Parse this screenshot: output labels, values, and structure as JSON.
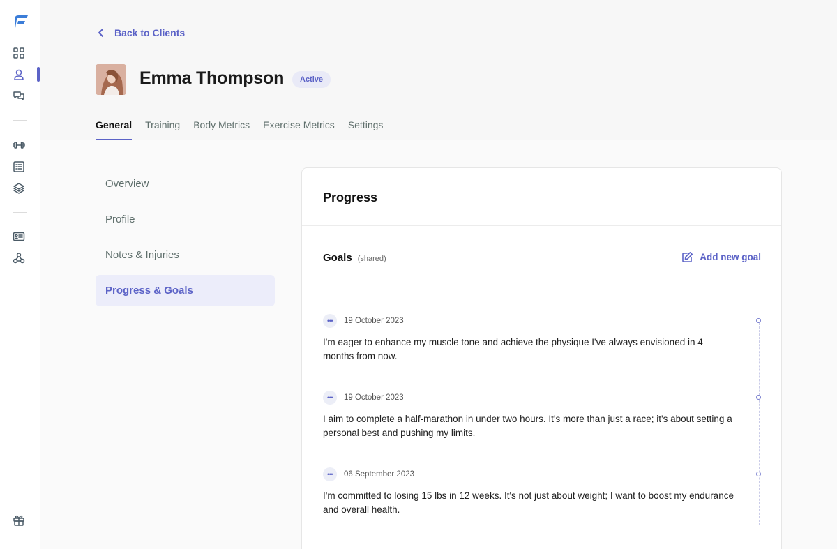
{
  "header": {
    "back_label": "Back to Clients",
    "client_name": "Emma Thompson",
    "status": "Active"
  },
  "tabs": [
    {
      "label": "General",
      "active": true
    },
    {
      "label": "Training",
      "active": false
    },
    {
      "label": "Body Metrics",
      "active": false
    },
    {
      "label": "Exercise Metrics",
      "active": false
    },
    {
      "label": "Settings",
      "active": false
    }
  ],
  "subnav": [
    {
      "label": "Overview",
      "active": false
    },
    {
      "label": "Profile",
      "active": false
    },
    {
      "label": "Notes & Injuries",
      "active": false
    },
    {
      "label": "Progress & Goals",
      "active": true
    }
  ],
  "card": {
    "title": "Progress",
    "goals_title": "Goals",
    "goals_subtitle": "(shared)",
    "add_goal_label": "Add new goal",
    "goals": [
      {
        "date": "19 October 2023",
        "text": "I'm eager to enhance my muscle tone and achieve the physique I've always envisioned in 4 months from now."
      },
      {
        "date": "19 October 2023",
        "text": "I aim to complete a half-marathon in under two hours. It's more than just a race; it's about setting a personal best and pushing my limits."
      },
      {
        "date": "06 September 2023",
        "text": "I'm committed to losing 15 lbs in 12 weeks. It's not just about weight; I want to boost my endurance and overall health."
      }
    ]
  },
  "colors": {
    "accent": "#5c63c7",
    "accent_light": "#ecedfa"
  },
  "sidebar_icons": [
    "dashboard-icon",
    "clients-icon",
    "messages-icon",
    "dumbbell-icon",
    "list-icon",
    "layers-icon",
    "id-card-icon",
    "webhook-icon",
    "gift-icon"
  ]
}
